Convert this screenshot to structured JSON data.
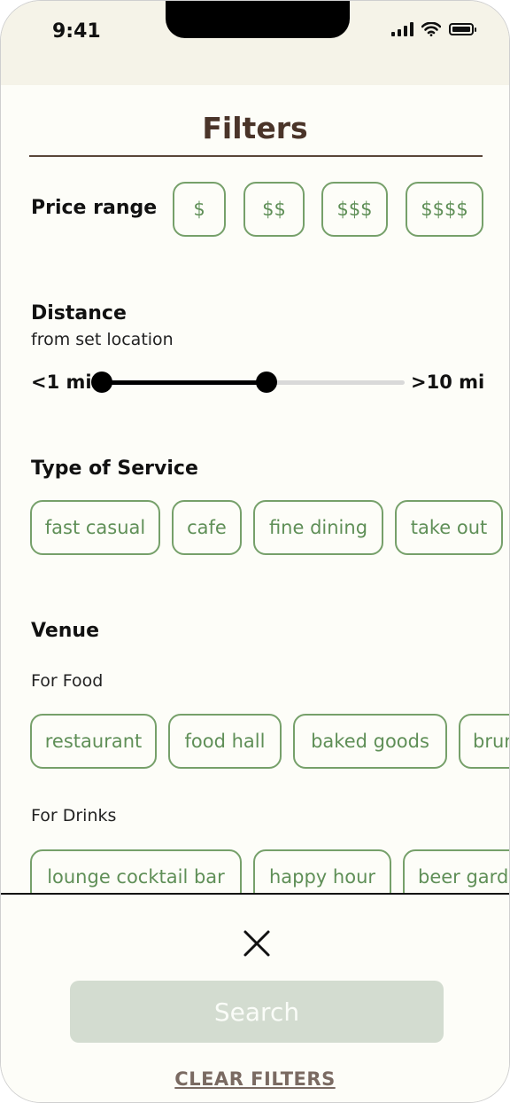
{
  "status": {
    "time": "9:41"
  },
  "title": "Filters",
  "price": {
    "label": "Price range",
    "options": [
      "$",
      "$$",
      "$$$",
      "$$$$"
    ]
  },
  "distance": {
    "label": "Distance",
    "sublabel": "from set location",
    "min_label": "<1 mi",
    "max_label": ">10 mi",
    "selected_range_fraction": [
      0.0,
      0.54
    ]
  },
  "service": {
    "label": "Type of Service",
    "options": [
      "fast casual",
      "cafe",
      "fine dining",
      "take out"
    ]
  },
  "venue": {
    "label": "Venue",
    "food": {
      "label": "For Food",
      "options": [
        "restaurant",
        "food hall",
        "baked goods",
        "brunch"
      ]
    },
    "drinks": {
      "label": "For Drinks",
      "options": [
        "lounge cocktail bar",
        "happy hour",
        "beer garden"
      ]
    }
  },
  "actions": {
    "search_label": "Search",
    "clear_label": "CLEAR FILTERS"
  },
  "colors": {
    "accent_green": "#76a06a",
    "title_brown": "#4a3429",
    "search_disabled": "#d3dcd0"
  }
}
